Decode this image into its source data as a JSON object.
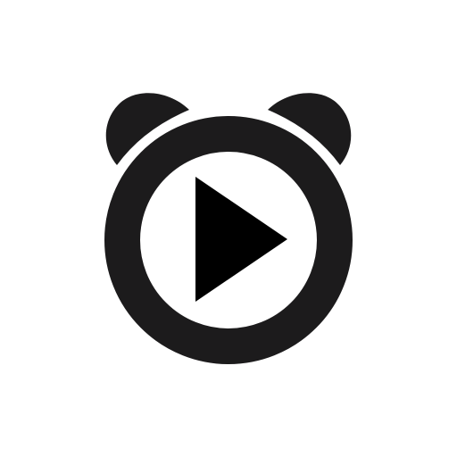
{
  "icon": {
    "name": "alarm-clock-play-icon",
    "foreground": "#1c1b1c",
    "background": "#ffffff"
  }
}
